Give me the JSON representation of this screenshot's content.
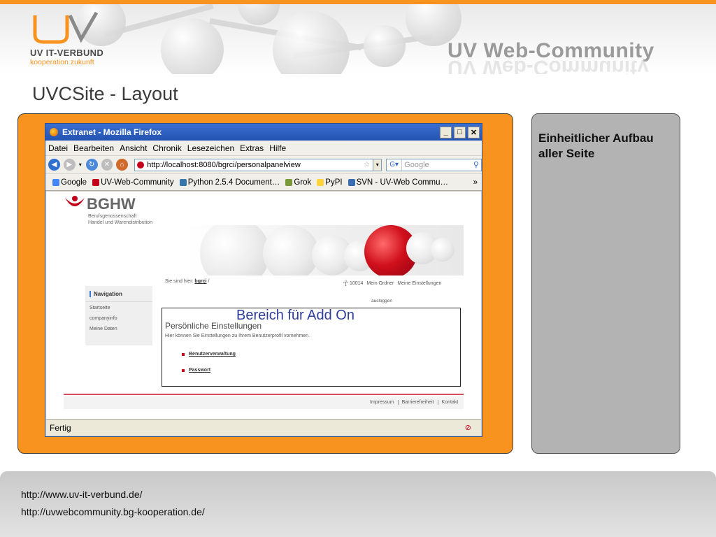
{
  "header": {
    "logo_name": "UV IT-VERBUND",
    "logo_sub": "kooperation zukunft",
    "brand": "UV Web-Community"
  },
  "slide_title": "UVCSite - Layout",
  "browser": {
    "title": "Extranet - Mozilla Firefox",
    "menu": [
      "Datei",
      "Bearbeiten",
      "Ansicht",
      "Chronik",
      "Lesezeichen",
      "Extras",
      "Hilfe"
    ],
    "url": "http://localhost:8080/bgrci/personalpanelview",
    "search_placeholder": "Google",
    "bookmarks": [
      "Google",
      "UV-Web-Community",
      "Python 2.5.4 Document…",
      "Grok",
      "PyPI",
      "SVN - UV-Web Commu…"
    ],
    "status": "Fertig"
  },
  "page": {
    "logo_text": "BGHW",
    "logo_sub1": "Berufsgenossenschaft",
    "logo_sub2": "Handel und Warendistribution",
    "breadcrumb_prefix": "Sie sind hier:",
    "breadcrumb_link": "bgrci",
    "breadcrumb_suffix": "/",
    "user_id": "10014",
    "my_folder": "Mein Ordner",
    "my_settings": "Meine Einstellungen",
    "logout": "ausloggen",
    "nav_title": "Navigation",
    "nav_items": [
      "Startseite",
      "companyinfo",
      "Meine Daten"
    ],
    "addon_label": "Bereich für Add On",
    "section_title": "Persönliche Einstellungen",
    "section_desc": "Hier können Sie Einstellungen zu Ihrem Benutzerprofil vornehmen.",
    "links": [
      "Benutzerverwaltung",
      "Passwort"
    ],
    "footer_links": [
      "Impressum",
      "Barrierefreiheit",
      "Kontakt"
    ]
  },
  "note": {
    "text": "Einheitlicher Aufbau aller Seite"
  },
  "footer": {
    "links": [
      "http://www.uv-it-verbund.de/",
      "http://uvwebcommunity.bg-kooperation.de/"
    ]
  },
  "colors": {
    "accent_orange": "#f7931e",
    "note_gray": "#b3b3b3",
    "brand_red": "#c3001a",
    "addon_blue": "#2e3c9a"
  }
}
